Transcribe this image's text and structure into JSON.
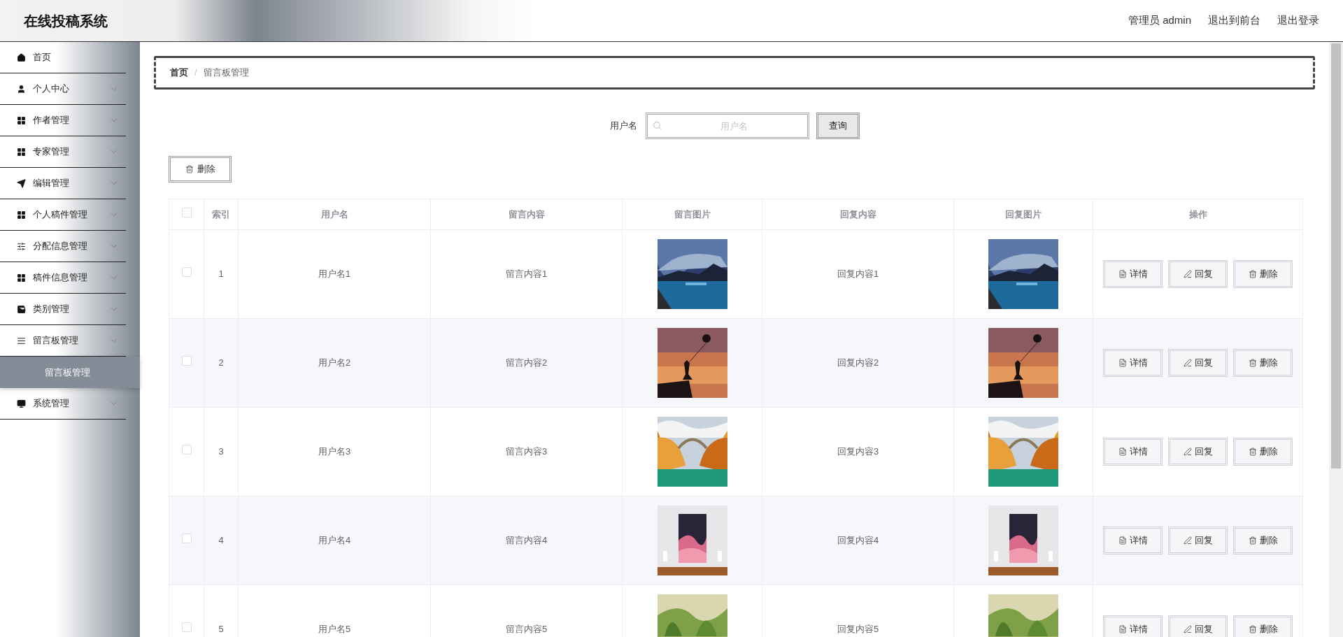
{
  "header": {
    "title": "在线投稿系统",
    "user": "管理员 admin",
    "links": [
      "退出到前台",
      "退出登录"
    ]
  },
  "sidebar": {
    "items": [
      {
        "label": "首页",
        "has_submenu": false
      },
      {
        "label": "个人中心",
        "has_submenu": true
      },
      {
        "label": "作者管理",
        "has_submenu": true
      },
      {
        "label": "专家管理",
        "has_submenu": true
      },
      {
        "label": "编辑管理",
        "has_submenu": true
      },
      {
        "label": "个人稿件管理",
        "has_submenu": true
      },
      {
        "label": "分配信息管理",
        "has_submenu": true
      },
      {
        "label": "稿件信息管理",
        "has_submenu": true
      },
      {
        "label": "类别管理",
        "has_submenu": true
      },
      {
        "label": "留言板管理",
        "has_submenu": true,
        "children": [
          {
            "label": "留言板管理",
            "selected": true
          }
        ]
      },
      {
        "label": "系统管理",
        "has_submenu": true
      }
    ]
  },
  "breadcrumb": {
    "items": [
      "首页",
      "留言板管理"
    ],
    "separator": "/"
  },
  "search": {
    "label": "用户名",
    "placeholder": "用户名",
    "button": "查询"
  },
  "delete_button": "删除",
  "table": {
    "header_checked": false,
    "columns": [
      "索引",
      "用户名",
      "留言内容",
      "留言图片",
      "回复内容",
      "回复图片",
      "操作"
    ],
    "rows": [
      {
        "checked": false,
        "index": "1",
        "username": "用户名1",
        "content": "留言内容1",
        "reply": "回复内容1",
        "actions": [
          "详情",
          "回复",
          "删除"
        ]
      },
      {
        "checked": false,
        "index": "2",
        "username": "用户名2",
        "content": "留言内容2",
        "reply": "回复内容2",
        "actions": [
          "详情",
          "回复",
          "删除"
        ]
      },
      {
        "checked": false,
        "index": "3",
        "username": "用户名3",
        "content": "留言内容3",
        "reply": "回复内容3",
        "actions": [
          "详情",
          "回复",
          "删除"
        ]
      },
      {
        "checked": false,
        "index": "4",
        "username": "用户名4",
        "content": "留言内容4",
        "reply": "回复内容4",
        "actions": [
          "详情",
          "回复",
          "删除"
        ]
      },
      {
        "checked": false,
        "index": "5",
        "username": "用户名5",
        "content": "留言内容5",
        "reply": "回复内容5",
        "actions": [
          "详情",
          "回复",
          "删除"
        ]
      }
    ]
  }
}
